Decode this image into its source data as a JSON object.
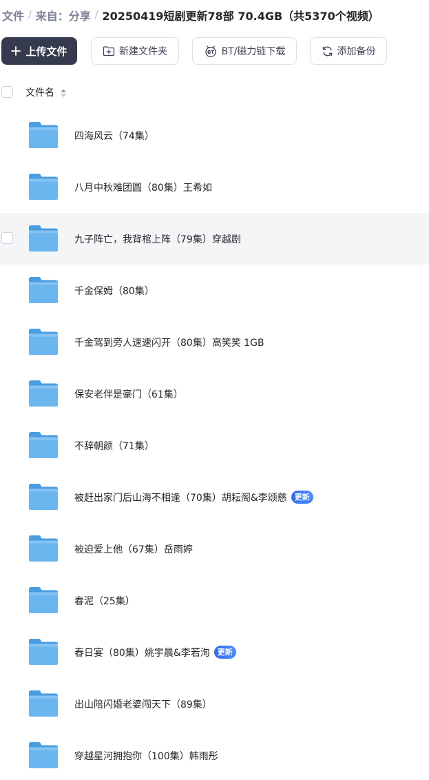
{
  "breadcrumb": {
    "items": [
      "文件",
      "来自：分享"
    ],
    "separator": "/",
    "current": "20250419短剧更新78部 70.4GB（共5370个视频）"
  },
  "toolbar": {
    "upload_label": "上传文件",
    "new_folder_label": "新建文件夹",
    "bt_label": "BT/磁力链下载",
    "backup_label": "添加备份"
  },
  "list": {
    "header_label": "文件名",
    "badge_label": "更新",
    "rows": [
      {
        "name": "四海风云（74集）",
        "badge": false
      },
      {
        "name": "八月中秋难团圆（80集）王希如",
        "badge": false
      },
      {
        "name": "九子阵亡，我背棺上阵（79集）穿越剧",
        "badge": false,
        "hover": true
      },
      {
        "name": "千金保姆（80集）",
        "badge": false
      },
      {
        "name": "千金驾到旁人速速闪开（80集）高笑笑  1GB",
        "badge": false
      },
      {
        "name": "保安老伴是豪门（61集）",
        "badge": false
      },
      {
        "name": "不辞朝颜（71集）",
        "badge": false
      },
      {
        "name": "被赶出家门后山海不相逢（70集）胡耘阁&李颂慈",
        "badge": true
      },
      {
        "name": "被迫爱上他（67集）岳雨婷",
        "badge": false
      },
      {
        "name": "春泥（25集）",
        "badge": false
      },
      {
        "name": "春日宴（80集）姚宇晨&李若洵",
        "badge": true
      },
      {
        "name": "出山陪闪婚老婆闯天下（89集）",
        "badge": false
      },
      {
        "name": "穿越星河拥抱你（100集）韩雨彤",
        "badge": false
      }
    ]
  },
  "colors": {
    "primary_button": "#353a4f",
    "folder": "#6cb6f0",
    "badge": "#2f6bf3",
    "hover_row": "#f4f5f7"
  }
}
